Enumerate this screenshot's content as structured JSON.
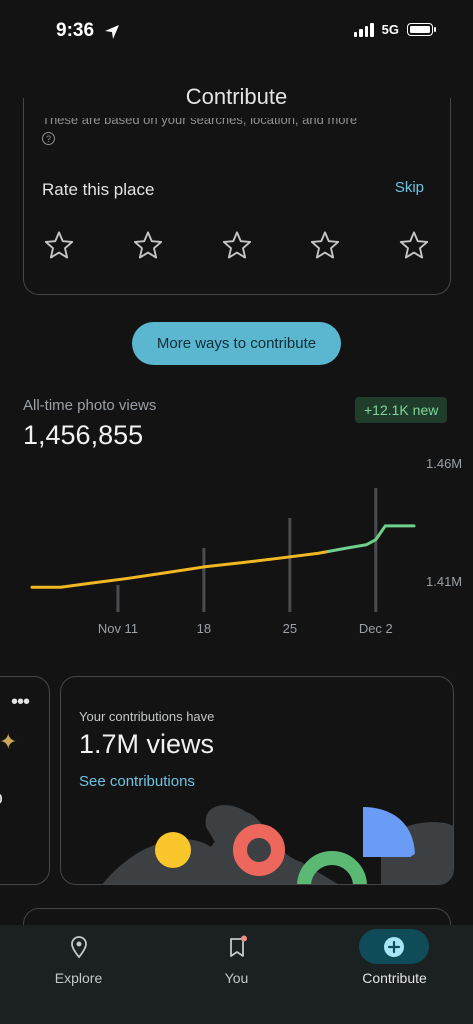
{
  "status": {
    "time": "9:36",
    "network": "5G"
  },
  "header": {
    "title": "Contribute"
  },
  "rate": {
    "partial_text": "These are based on your searches, location, and more",
    "label": "Rate this place",
    "skip": "Skip",
    "rating": 0,
    "max_rating": 5
  },
  "more_ways_button": "More ways to contribute",
  "photo_views": {
    "label": "All-time photo views",
    "value": "1,456,855",
    "new_badge": "+12.1K new"
  },
  "chart_data": {
    "type": "line",
    "title": "",
    "xlabel": "",
    "ylabel": "",
    "x_ticks": [
      "Nov 11",
      "18",
      "25",
      "Dec 2"
    ],
    "y_ticks": [
      "1.46M",
      "1.41M"
    ],
    "ylim": [
      1.4,
      1.47
    ],
    "series": [
      {
        "segment": "previous",
        "color": "#f2b824",
        "points": [
          [
            0,
            1.4083
          ],
          [
            3,
            1.4083
          ],
          [
            6,
            1.4105
          ],
          [
            10,
            1.4133
          ],
          [
            14,
            1.4165
          ],
          [
            18,
            1.4198
          ],
          [
            22,
            1.4222
          ],
          [
            26,
            1.4248
          ],
          [
            30,
            1.4275
          ],
          [
            31,
            1.4285
          ]
        ]
      },
      {
        "segment": "new",
        "color": "#6fcf8c",
        "points": [
          [
            31,
            1.4285
          ],
          [
            33,
            1.4305
          ],
          [
            35,
            1.4323
          ],
          [
            36,
            1.4352
          ],
          [
            37,
            1.443
          ],
          [
            40,
            1.443
          ]
        ]
      }
    ],
    "grid": false,
    "colors": {
      "previous": "#f2b824",
      "new": "#6fcf8c"
    }
  },
  "contributions": {
    "label": "Your contributions have",
    "value": "1.7M views",
    "link": "See contributions",
    "left_card_partial": "to"
  },
  "nav": {
    "items": [
      {
        "label": "Explore",
        "icon": "pin-icon"
      },
      {
        "label": "You",
        "icon": "bookmark-icon"
      },
      {
        "label": "Contribute",
        "icon": "add-circle-icon",
        "active": true
      }
    ]
  }
}
